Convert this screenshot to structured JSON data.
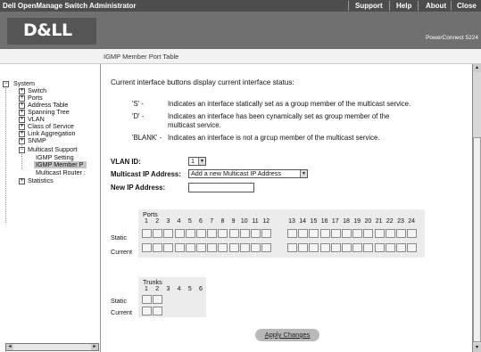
{
  "topbar": {
    "app_title": "Dell OpenManage Switch Administrator",
    "links": [
      "Support",
      "Help",
      "About",
      "Close"
    ]
  },
  "header": {
    "logo_text": "D&LL",
    "model": "PowerConnect 5224"
  },
  "page_title": "IGMP Member Port Table",
  "tree": {
    "root": "System",
    "items": [
      "Switch",
      "Ports",
      "Address Table",
      "Spanning Tree",
      "VLAN",
      "Class of Service",
      "Link Aggregation",
      "SNMP",
      "Multicast Support"
    ],
    "multicast_children": [
      "IGMP Setting",
      "IGMP Member P",
      "Multicast Router :"
    ],
    "after": "Statistics",
    "selected": "IGMP Member P"
  },
  "main": {
    "intro": "Current interface buttons display current interface status:",
    "legend": [
      {
        "key": "'S' -",
        "text": "Indicates an interface statically set as a group member of the multicast service."
      },
      {
        "key": "'D' -",
        "text": "Indicates an interface has been cynamically set as group member of the",
        "text2": "multicast service."
      },
      {
        "key": "'BLANK' -",
        "text": "Indicates an interface is not a grcup member of the multicast service."
      }
    ],
    "vlan_label": "VLAN ID:",
    "vlan_value": "1",
    "mcast_label": "Multicast IP Address:",
    "mcast_value": "Add a new Multicast IP Address",
    "newip_label": "New IP Address:",
    "newip_value": "",
    "ports_heading": "Ports",
    "ports_group1": [
      "1",
      "2",
      "3",
      "4",
      "5",
      "6",
      "7",
      "8",
      "9",
      "10",
      "11",
      "12"
    ],
    "ports_group2": [
      "13",
      "14",
      "15",
      "16",
      "17",
      "18",
      "19",
      "20",
      "21",
      "22",
      "23",
      "24"
    ],
    "row_static": "Static",
    "row_current": "Current",
    "trunks_heading": "Trunks",
    "trunk_numbers": [
      "1",
      "2",
      "3",
      "4",
      "5",
      "6"
    ],
    "apply_label": "Apply Changes"
  }
}
